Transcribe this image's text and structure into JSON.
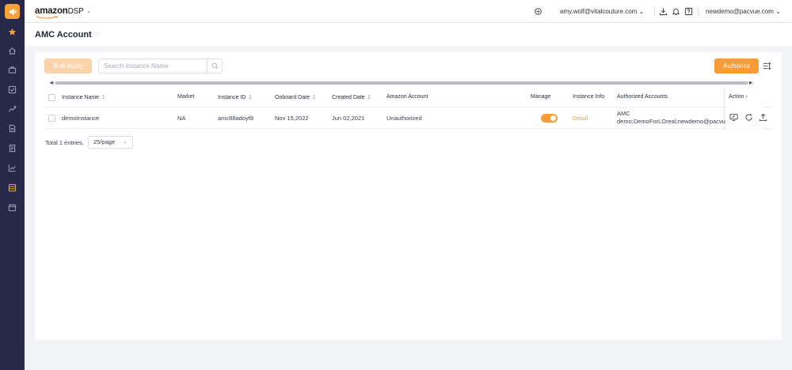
{
  "app": {
    "brand": "amazon",
    "brand_suffix": "DSP",
    "accent": "#f99b36",
    "sidebar_bg": "#262a48"
  },
  "header": {
    "user_email": "amy.wolf@vitalcouture.com",
    "account_email": "newdemo@pacvue.com"
  },
  "page": {
    "title": "AMC Account"
  },
  "toolbar": {
    "bulk_apply_label": "Bulk Apply",
    "search_placeholder": "Search Instance Name",
    "authorize_label": "Authorize"
  },
  "table": {
    "columns": [
      "Instance Name",
      "Market",
      "Instance ID",
      "Onboard Date",
      "Created Date",
      "Amazon Account",
      "Manage",
      "Instance Info",
      "Authorized Accounts",
      "Action"
    ],
    "rows": [
      {
        "instance_name": "demoInstance",
        "market": "NA",
        "instance_id": "amc88adoyf8",
        "onboard_date": "Nov 15,2022",
        "created_date": "Jun 02,2021",
        "amazon_account": "Unauthorized",
        "manage": true,
        "instance_info": "Detail",
        "authorized_line1": "AMC",
        "authorized_line2": "demo;DemoForLOreal;newdemo@pacvue"
      }
    ]
  },
  "pagination": {
    "total": "Total 1 entries,",
    "page_size": "25/page"
  }
}
